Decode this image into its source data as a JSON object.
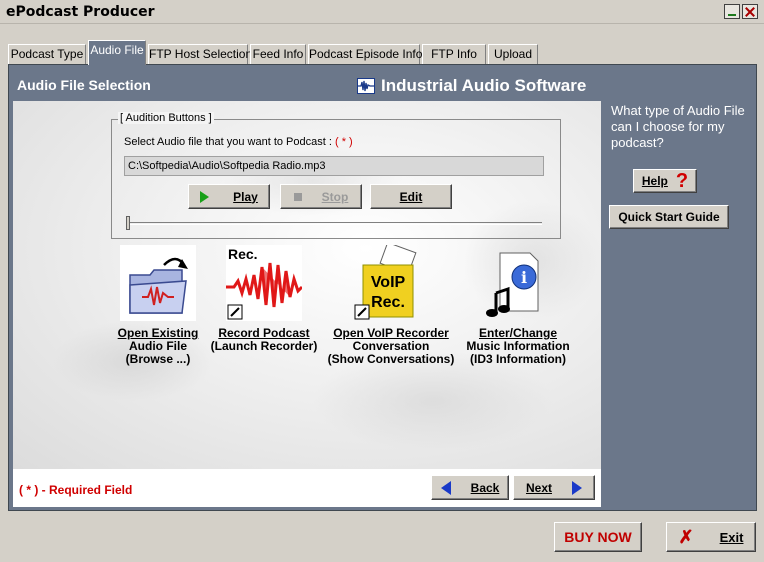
{
  "window": {
    "title": "ePodcast Producer",
    "minimize_label": "",
    "close_label": ""
  },
  "tabs": [
    {
      "label": "Podcast Type",
      "active": false
    },
    {
      "label": "Audio File",
      "active": true
    },
    {
      "label": "FTP Host Selection",
      "active": false
    },
    {
      "label": "Feed Info",
      "active": false
    },
    {
      "label": "Podcast Episode Info",
      "active": false
    },
    {
      "label": "FTP Info",
      "active": false
    },
    {
      "label": "Upload",
      "active": false
    }
  ],
  "panel": {
    "title": "Audio File Selection",
    "brand": "Industrial Audio Software"
  },
  "audition": {
    "legend": "[ Audition Buttons ]",
    "prompt": "Select Audio file that you want to Podcast :",
    "required_marker": "( * )",
    "file_path": "C:\\Softpedia\\Audio\\Softpedia Radio.mp3",
    "play_label": "Play",
    "stop_label": "Stop",
    "edit_label": "Edit",
    "slider_position": 0
  },
  "actions": [
    {
      "line1": "Open Existing",
      "line2": "Audio File",
      "line3": "(Browse ...)",
      "icon": "folder-audio-icon"
    },
    {
      "line1": "Record Podcast",
      "line2": "(Launch Recorder)",
      "line3": "",
      "icon": "record-icon"
    },
    {
      "line1": "Open VoIP Recorder",
      "line2": "Conversation",
      "line3": "(Show Conversations)",
      "icon": "voip-icon"
    },
    {
      "line1": "Enter/Change",
      "line2": "Music Information",
      "line3": "(ID3 Information)",
      "icon": "id3-info-icon"
    }
  ],
  "record_icon_text": "Rec.",
  "voip_icon_text_1": "VoIP",
  "voip_icon_text_2": "Rec.",
  "footer": {
    "required_note": "( * ) - Required Field",
    "back_label": "Back",
    "next_label": "Next"
  },
  "side": {
    "question": "What type of Audio File can I choose for my podcast?",
    "help_label": "Help",
    "help_symbol": "?",
    "quick_start_label": "Quick Start Guide"
  },
  "bottom": {
    "buy_now_label": "BUY NOW",
    "exit_label": "Exit"
  },
  "colors": {
    "panel_bg": "#6b778a",
    "accent_red": "#c00000",
    "accent_blue": "#1a3ac8",
    "play_green": "#18a018"
  }
}
